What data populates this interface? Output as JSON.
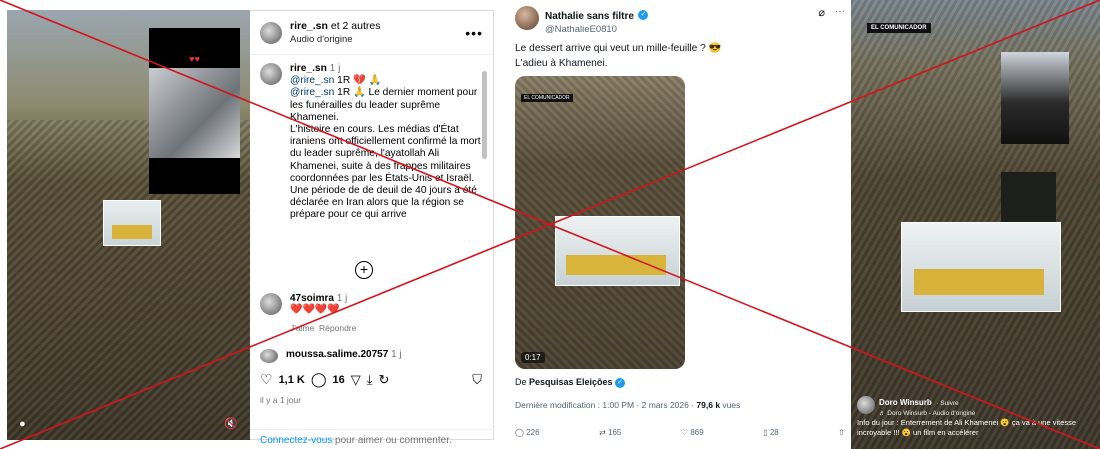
{
  "instagram": {
    "header": {
      "user": "rire_.sn",
      "and_others": "et 2 autres",
      "audio": "Audio d'origine"
    },
    "caption": {
      "user": "rire_.sn",
      "time": "1 j",
      "mention1": "@rire_.sn",
      "line1_suffix": "1R 💔 🙏",
      "mention2": "@rire_.sn",
      "line2_suffix": "1R 🙏 Le dernier moment pour les funérailles du leader suprême Khamenei.",
      "body": "L'histoire en cours. Les médias d'État iraniens ont officiellement confirmé la mort du leader suprême, l'ayatollah Ali Khamenei, suite à des frappes militaires coordonnées par les États-Unis et Israël. Une période de de deuil de 40 jours a été déclarée en Iran alors que la région se prépare pour ce qui arrive"
    },
    "comments": [
      {
        "user": "47soimra",
        "time": "1 j",
        "text": "❤️❤️❤️❤️",
        "like": "J'aime",
        "reply": "Répondre"
      },
      {
        "user": "moussa.salime.20757",
        "time": "1 j"
      }
    ],
    "likes": "1,1 K",
    "comments_count": "16",
    "ago": "il y a 1 jour",
    "footer_login": "Connectez-vous",
    "footer_rest": " pour aimer ou commenter."
  },
  "x_post": {
    "name": "Nathalie sans filtre",
    "handle": "@NathalieE0810",
    "text_line1": "Le dessert arrive qui veut un mille-feuille ? 😎",
    "text_line2": "L'adieu à Khamenei.",
    "video_duration": "0:17",
    "from_prefix": "De ",
    "from_source": "Pesquisas Eleições",
    "meta_prefix": "Dernière modification : 1:00 PM · 2 mars 2026 · ",
    "views": "79,6 k",
    "views_suffix": " vues",
    "actions": {
      "replies": "226",
      "reposts": "165",
      "likes": "869",
      "bookmarks": "28"
    }
  },
  "tiktok": {
    "channel_label": "EL COMUNICADOR",
    "user": "Doro Winsurb",
    "follow": "· Suivre",
    "sound": "♬ Doro Winsurb - Audio d'origine",
    "caption": "Info du jour : Enterrement de Ali Khamenei 😮 ça va à une vitesse incroyable !!! 😮 un film en accélérer"
  },
  "colors": {
    "cross": "#d2141c",
    "link": "#00376b",
    "login": "#0095f6",
    "x_verified": "#1d9bf0"
  }
}
